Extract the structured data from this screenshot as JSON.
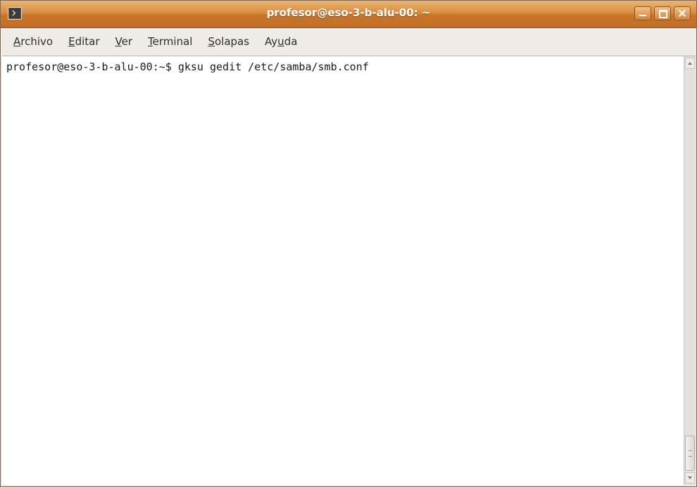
{
  "window": {
    "title": "profesor@eso-3-b-alu-00: ~",
    "app_icon": "terminal-icon",
    "controls": [
      "minimize-icon",
      "maximize-icon",
      "close-icon"
    ]
  },
  "menubar": {
    "items": [
      {
        "mnemonic": "A",
        "rest": "rchivo"
      },
      {
        "mnemonic": "E",
        "rest": "ditar"
      },
      {
        "mnemonic": "V",
        "rest": "er"
      },
      {
        "mnemonic": "T",
        "rest": "erminal"
      },
      {
        "mnemonic": "S",
        "rest": "olapas"
      },
      {
        "prefix": "Ay",
        "mnemonic": "u",
        "rest": "da"
      }
    ]
  },
  "terminal": {
    "lines": [
      "profesor@eso-3-b-alu-00:~$ gksu gedit /etc/samba/smb.conf"
    ]
  },
  "colors": {
    "titlebar": "#d98d3e",
    "menubar_bg": "#efebe7",
    "terminal_bg": "#ffffff",
    "terminal_fg": "#1a1a1a"
  }
}
